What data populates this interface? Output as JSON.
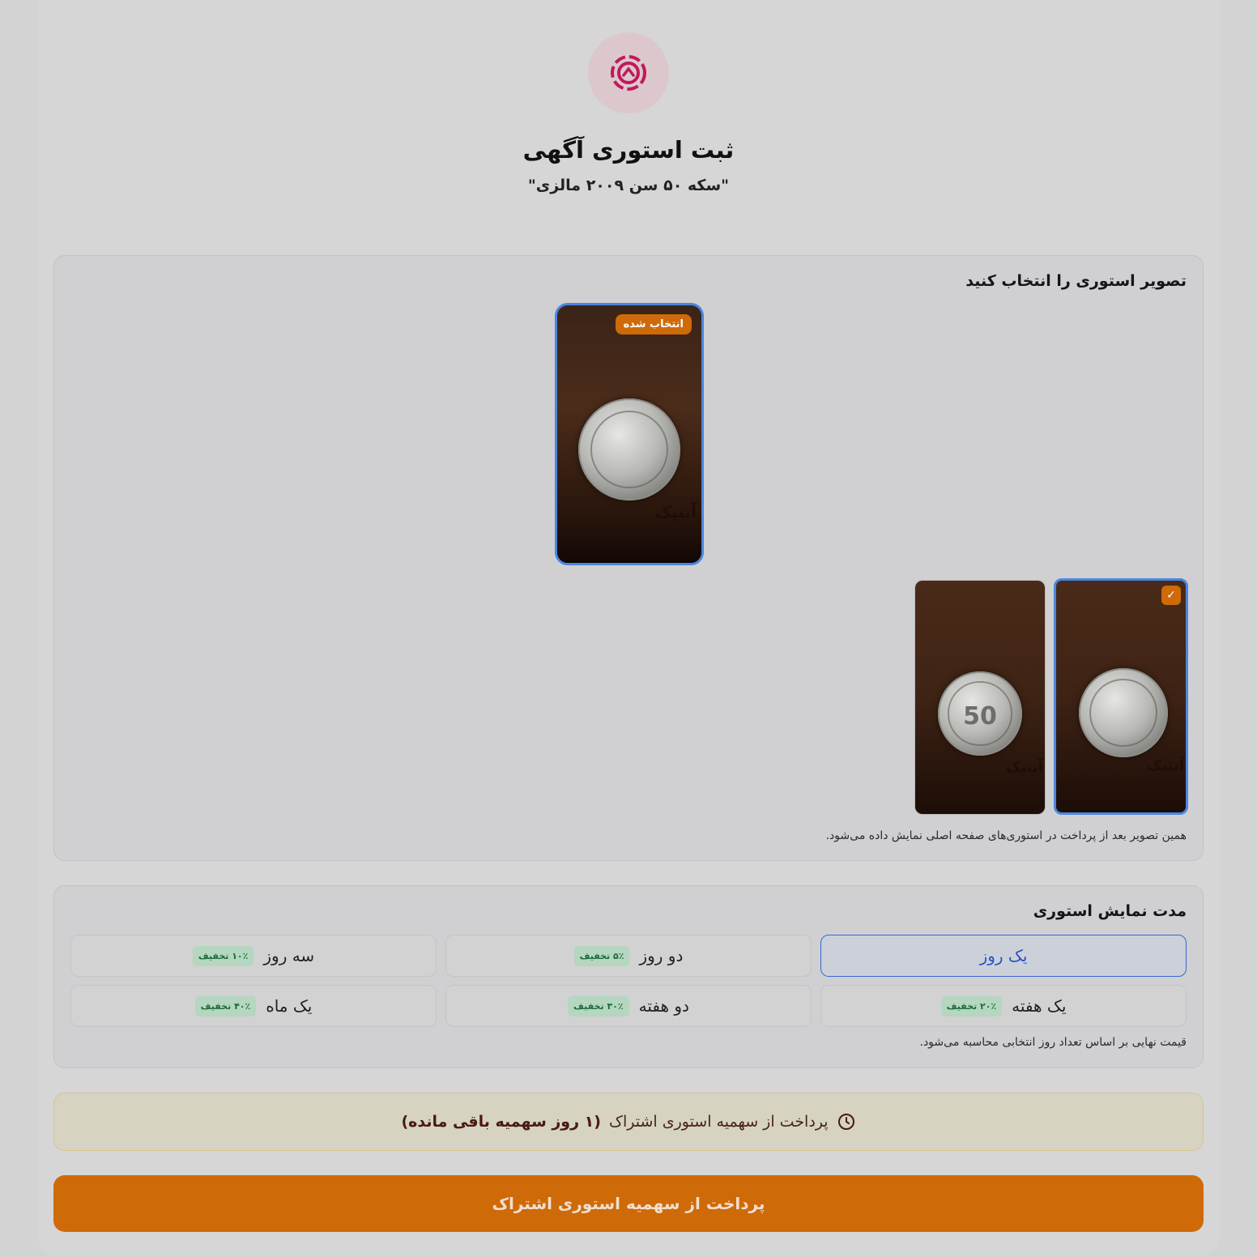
{
  "header": {
    "title": "ثبت استوری آگهی",
    "subtitle": "\"سکه ۵۰ سن ۲۰۰۹ مالزی\"",
    "logo_icon": "logo-icon"
  },
  "image_section": {
    "heading": "تصویر استوری را انتخاب کنید",
    "selected_badge": "انتخاب شده",
    "watermark": "آنتیک",
    "check_mark": "✓",
    "coin_label": "50",
    "hint": "همین تصویر بعد از پرداخت در استوری‌های صفحه اصلی نمایش داده می‌شود."
  },
  "duration_section": {
    "heading": "مدت نمایش استوری",
    "options": [
      {
        "label": "یک روز",
        "discount": "",
        "active": true
      },
      {
        "label": "دو روز",
        "discount": "۵٪ تخفیف",
        "active": false
      },
      {
        "label": "سه روز",
        "discount": "۱۰٪ تخفیف",
        "active": false
      },
      {
        "label": "یک هفته",
        "discount": "۲۰٪ تخفیف",
        "active": false
      },
      {
        "label": "دو هفته",
        "discount": "۳۰٪ تخفیف",
        "active": false
      },
      {
        "label": "یک ماه",
        "discount": "۴۰٪ تخفیف",
        "active": false
      }
    ],
    "hint": "قیمت نهایی بر اساس تعداد روز انتخابی محاسبه می‌شود."
  },
  "quota": {
    "text": "پرداخت از سهمیه استوری اشتراک",
    "remaining": "(۱ روز سهمیه باقی مانده)"
  },
  "pay_button": "پرداخت از سهمیه استوری اشتراک",
  "colors": {
    "accent": "#cf6a08",
    "selection": "#4a86e0",
    "active_option": "#3468d4",
    "discount_bg": "#b5d6bf",
    "discount_text": "#1d6b3b"
  }
}
